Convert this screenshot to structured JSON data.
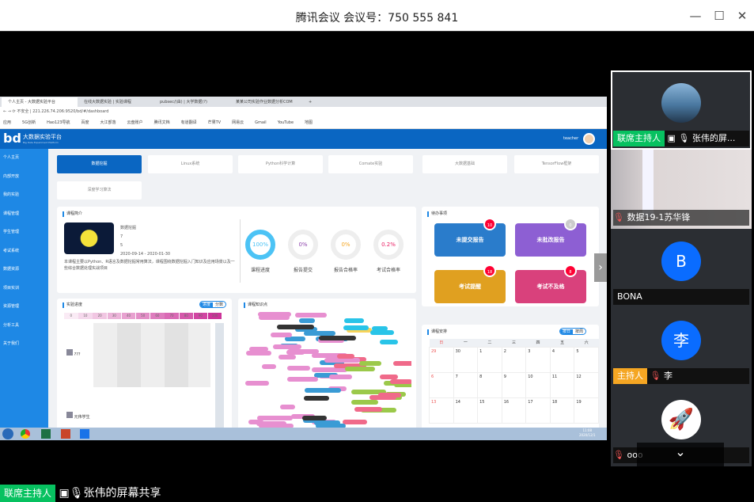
{
  "window": {
    "title": "腾讯会议 会议号：750 555 841",
    "minimize": "—",
    "maximize": "☐",
    "close": "✕"
  },
  "browser": {
    "tabs": [
      "个人主页 - 大数据实验平台",
      "在线大数据实验 | 实验课程",
      "pubsec/(由) | 大学数据(?)",
      "某某公司实验作业数据分析COM"
    ],
    "new_tab": "+",
    "address": "不安全 | 221.226.74.206:9520/bd/#/dashboard",
    "bookmarks": [
      "应用",
      "5G创新",
      "Hao123导航",
      "百度",
      "大江部落",
      "云盘账户",
      "腾讯文档",
      "有道翻译",
      "芒果TV",
      "网易云",
      "Gmail",
      "YouTube",
      "地图"
    ]
  },
  "app": {
    "logo": "bd",
    "name": "大数据实验平台",
    "subtitle": "Big Data Experiment Platform",
    "user": "teacher",
    "sidebar": [
      "个人主页",
      "内部开放",
      "我的实验",
      "课程管理",
      "学生管理",
      "考试系统",
      "数据资源",
      "项目实训",
      "资源管理",
      "分析工具",
      "关于我们"
    ],
    "course_tabs": [
      "数据挖掘",
      "Linux系统",
      "Python科学计算",
      "Comate实验",
      "大数据基础",
      "TensorFlow框架",
      "深度学习算法"
    ],
    "intro": {
      "title": "课程简介",
      "name": "数据挖掘",
      "teachers": "7",
      "students": "5",
      "dates": "2020-09-14 - 2020-01-30",
      "desc": "本课程主要以Python、R语言及数据挖掘常用算法，课程围绕数据挖掘入门知识及应用场景以及一些综合数据处理实战项目"
    },
    "stats": [
      {
        "value": "100%",
        "label": "课程进度",
        "color": "#4cc3f5",
        "pct": 100
      },
      {
        "value": "0%",
        "label": "报告提交",
        "color": "#8e44ad",
        "pct": 0
      },
      {
        "value": "0%",
        "label": "报告合格率",
        "color": "#f5a623",
        "pct": 0
      },
      {
        "value": "0.2%",
        "label": "考试合格率",
        "color": "#e91e63",
        "pct": 0.2
      }
    ],
    "todo": {
      "title": "待办事项",
      "items": [
        {
          "label": "未提交报告",
          "count": "10",
          "color": "#2a7ccb"
        },
        {
          "label": "未批改报告",
          "count": "0",
          "color": "#8d5fd3"
        },
        {
          "label": "考试提醒",
          "count": "18",
          "color": "#e0a020"
        },
        {
          "label": "考试不及格",
          "count": "8",
          "color": "#d9417c"
        }
      ]
    },
    "progress": {
      "title": "实验进度",
      "toggle": [
        "进度",
        "分数"
      ],
      "scale": [
        "0",
        "10",
        "20",
        "30",
        "40",
        "50",
        "60",
        "70",
        "80",
        "90",
        "100"
      ],
      "students": [
        "???",
        "元伟学生"
      ]
    },
    "mindmap": {
      "title": "课程知识点"
    },
    "calendar": {
      "title": "课程安排",
      "toggle": [
        "按日",
        "按周"
      ],
      "weekdays": [
        "日",
        "一",
        "二",
        "三",
        "四",
        "五",
        "六"
      ],
      "weeks": [
        [
          "29",
          "30",
          "1",
          "2",
          "3",
          "4",
          "5"
        ],
        [
          "6",
          "7",
          "8",
          "9",
          "10",
          "11",
          "12"
        ],
        [
          "13",
          "14",
          "15",
          "16",
          "17",
          "18",
          "19"
        ]
      ]
    }
  },
  "taskbar": {
    "time": "11:08",
    "date": "2020/12/1"
  },
  "participants": [
    {
      "role": "联席主持人",
      "name": "张伟的屏...",
      "role_color": "#07c160",
      "avatar": "landscape"
    },
    {
      "name": "数据19-1苏华锋",
      "muted": true,
      "avatar": "video"
    },
    {
      "name": "BONA",
      "avatar_text": "B"
    },
    {
      "role": "主持人",
      "name": "李",
      "role_color": "#f5a623",
      "muted": true,
      "avatar_text": "李"
    },
    {
      "name": "ooo",
      "muted": true,
      "avatar": "rocket"
    }
  ],
  "presenter": {
    "role": "联席主持人",
    "label": "张伟的屏幕共享"
  },
  "collapse": "⌄"
}
